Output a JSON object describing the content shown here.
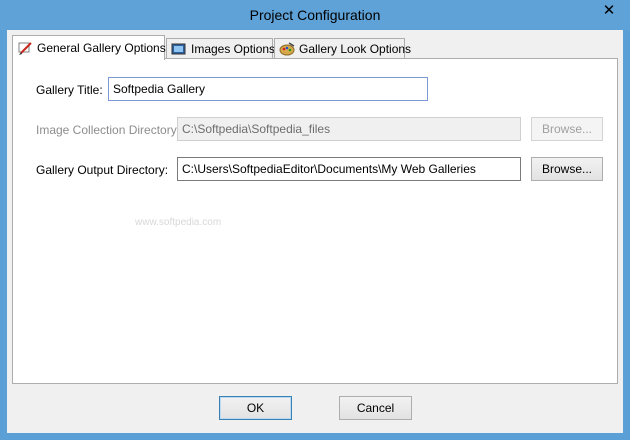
{
  "window": {
    "title": "Project Configuration",
    "close_label": "✕"
  },
  "tabs": [
    {
      "label": "General Gallery Options",
      "icon": "pencil-icon",
      "active": true
    },
    {
      "label": "Images Options",
      "icon": "image-icon",
      "active": false
    },
    {
      "label": "Gallery Look Options",
      "icon": "palette-icon",
      "active": false
    }
  ],
  "form": {
    "gallery_title_label": "Gallery Title:",
    "gallery_title_value": "Softpedia Gallery",
    "image_dir_label": "Image Collection Directory:",
    "image_dir_value": "C:\\Softpedia\\Softpedia_files",
    "image_dir_browse": "Browse...",
    "output_dir_label": "Gallery Output Directory:",
    "output_dir_value": "C:\\Users\\SoftpediaEditor\\Documents\\My Web Galleries",
    "output_dir_browse": "Browse...",
    "watermark": "www.softpedia.com"
  },
  "footer": {
    "ok_label": "OK",
    "cancel_label": "Cancel"
  },
  "colors": {
    "title_bar": "#5ea2d8",
    "dialog_bg": "#f0f0f0"
  }
}
